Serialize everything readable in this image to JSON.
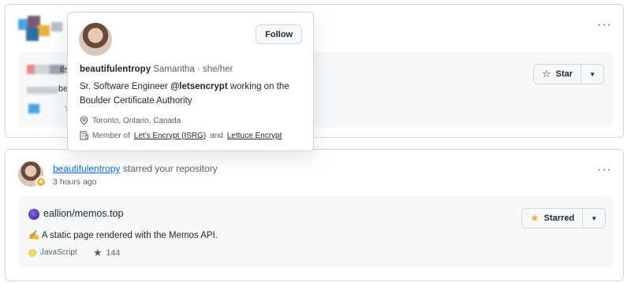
{
  "hovercard": {
    "username": "beautifulentropy",
    "fullname": "Samantha",
    "pronouns": "she/her",
    "bio_prefix": "Sr. Software Engineer",
    "bio_org": "@letsencrypt",
    "bio_suffix": "working on the",
    "bio_line2": "Boulder Certificate Authority",
    "location": "Toronto, Ontario, Canada",
    "member_prefix": "Member of",
    "org1": "Let's Encrypt (ISRG)",
    "member_and": "and",
    "org2": "Lettuce Encrypt",
    "follow_label": "Follow"
  },
  "top_card": {
    "partial_text_1": "ils",
    "partial_text_2": "be",
    "star_label": "Star",
    "more_label": "···"
  },
  "event": {
    "actor": "beautifulentropy",
    "action": "starred your repository",
    "time": "3 hours ago",
    "more_label": "···"
  },
  "repo": {
    "name": "eallion/memos.top",
    "description": "✍️ A static page rendered with the Memos API.",
    "language": "JavaScript",
    "language_color": "#f1e05a",
    "stars": "144",
    "starred_label": "Starred"
  },
  "colors": {
    "border": "#d0d7de",
    "link": "#0969da",
    "muted": "#57606a",
    "star_fill": "#e3b341"
  }
}
